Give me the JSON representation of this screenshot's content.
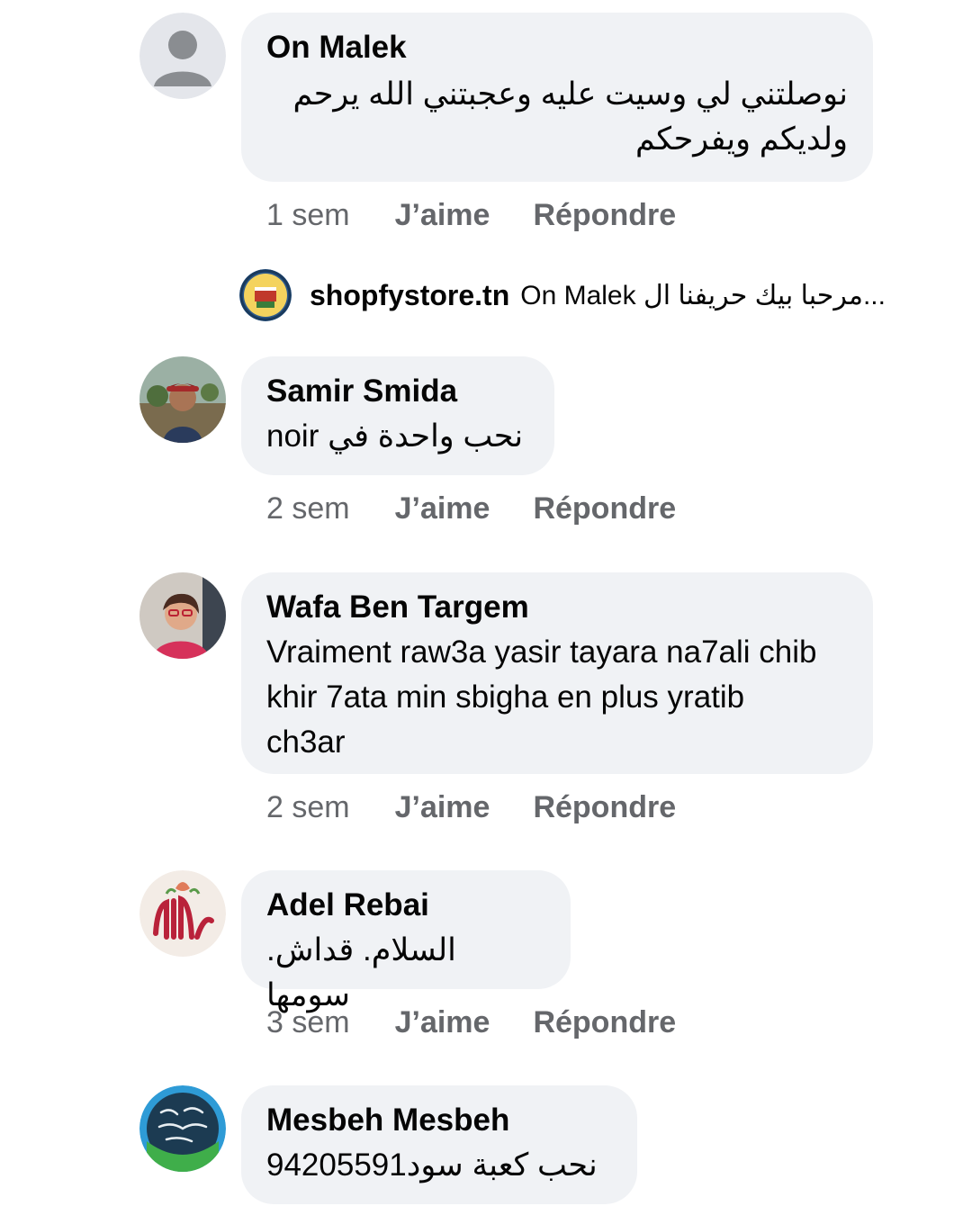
{
  "comments": [
    {
      "author": "On Malek",
      "text": "نوصلتني لي وسيت عليه وعجبتني الله يرحم ولديكم ويفرحكم",
      "time": "1 sem",
      "like_label": "J’aime",
      "reply_label": "Répondre"
    },
    {
      "author": "Samir Smida",
      "text": "نحب واحدة في noir",
      "time": "2 sem",
      "like_label": "J’aime",
      "reply_label": "Répondre"
    },
    {
      "author": "Wafa Ben Targem",
      "text": "Vraiment raw3a yasir tayara na7ali chib khir 7ata min sbigha en plus yratib ch3ar",
      "time": "2 sem",
      "like_label": "J’aime",
      "reply_label": "Répondre"
    },
    {
      "author": "Adel Rebai",
      "text": "السلام. قداش. سومها",
      "time": "3 sem",
      "like_label": "J’aime",
      "reply_label": "Répondre"
    },
    {
      "author": "Mesbeh Mesbeh",
      "text": "نحب كعبة سود94205591"
    }
  ],
  "reply": {
    "author": "shopfystore.tn",
    "preview": "On Malek مرحبا بيك حريفنا ال..."
  },
  "colors": {
    "bubble": "#f0f2f5",
    "meta_text": "#65676b",
    "primary_text": "#050505"
  }
}
